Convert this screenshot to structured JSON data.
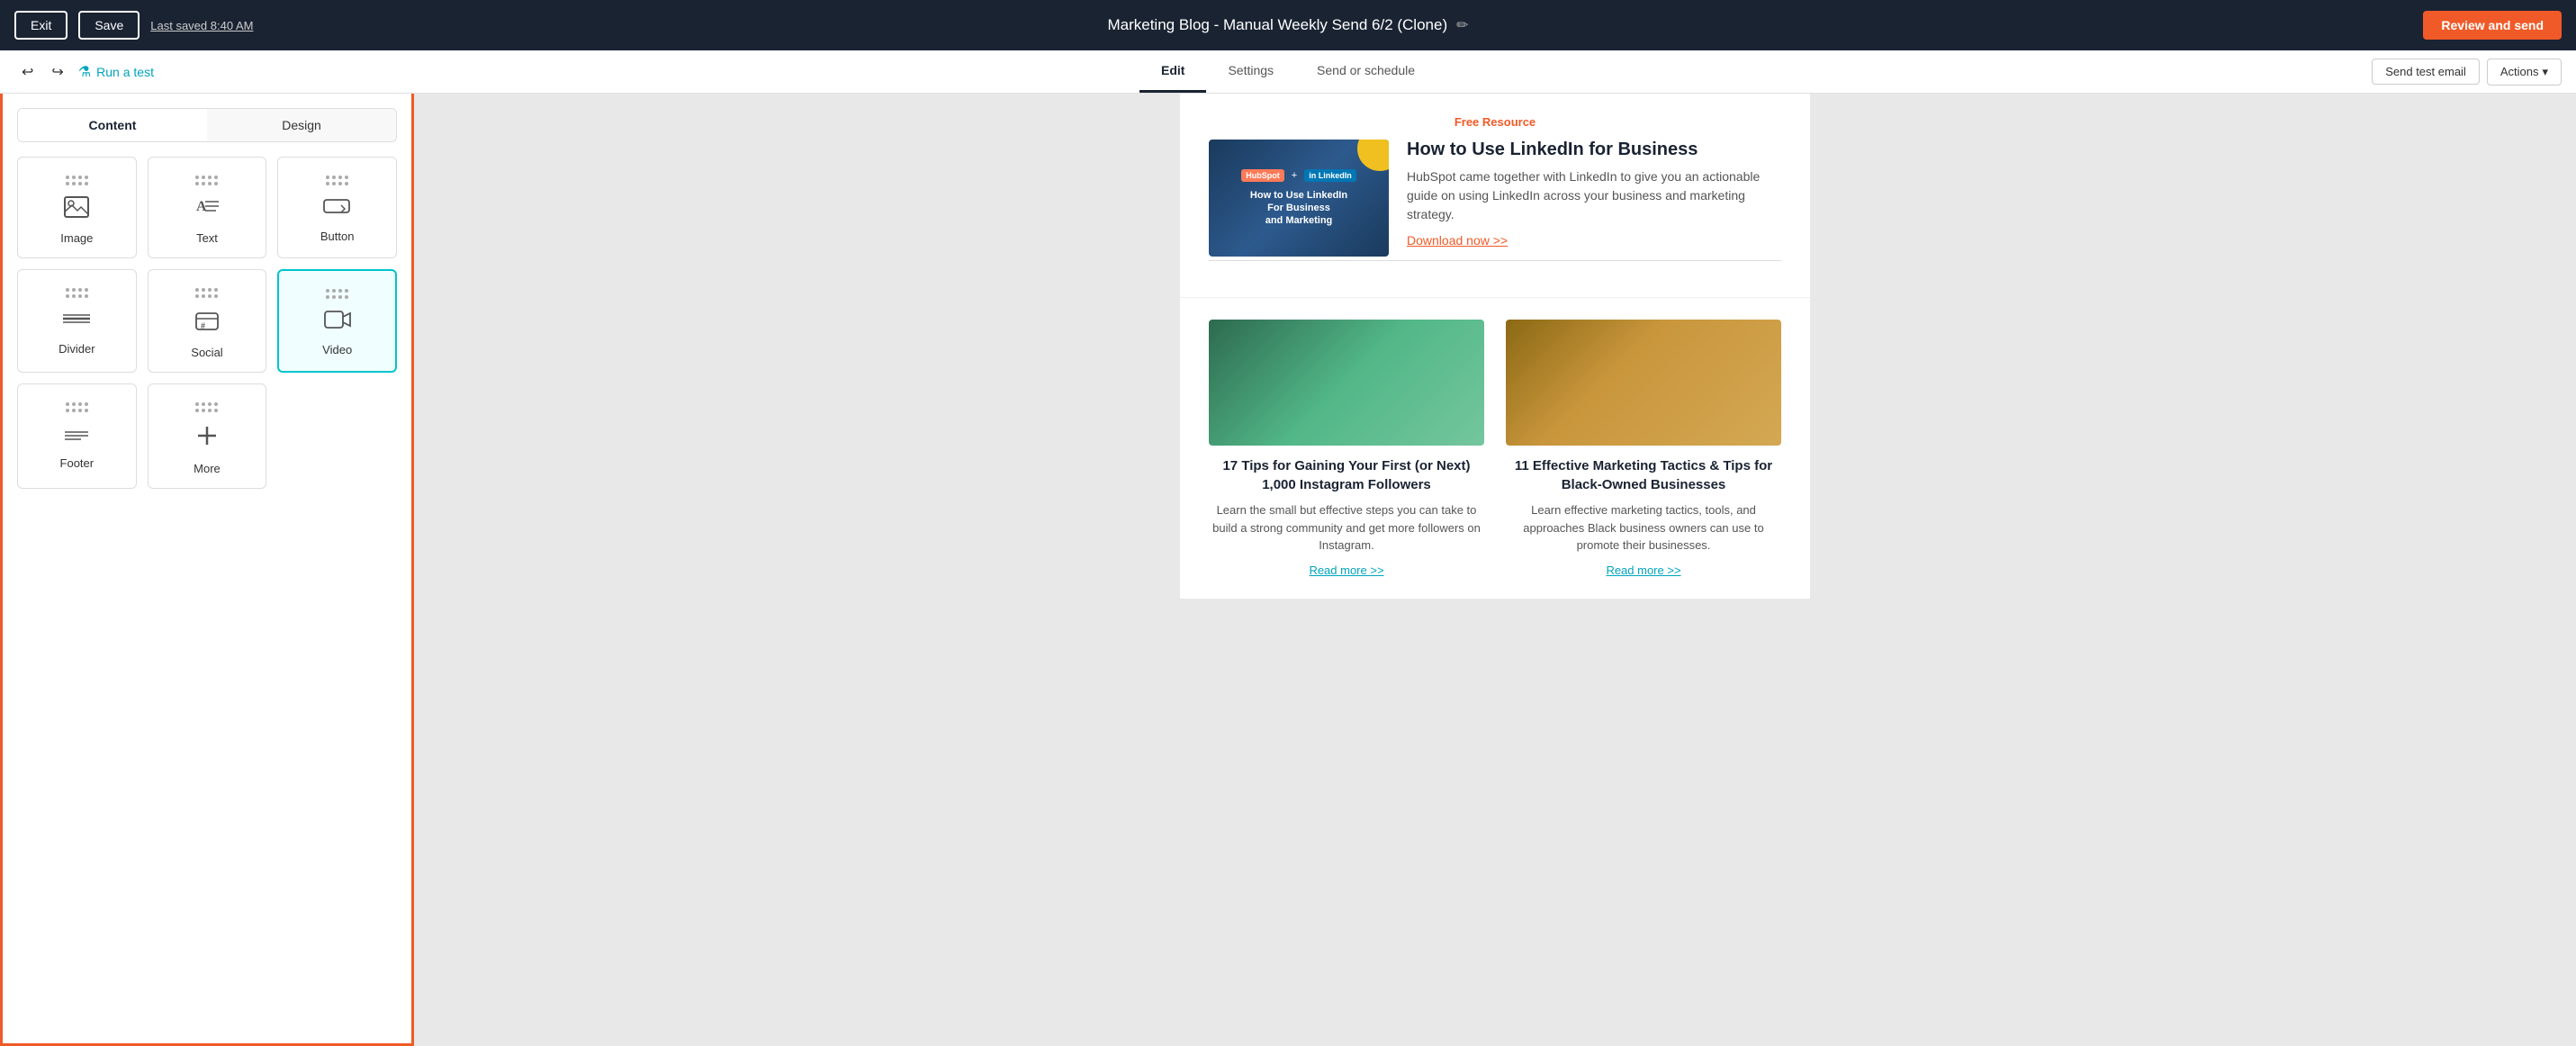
{
  "topbar": {
    "exit_label": "Exit",
    "save_label": "Save",
    "last_saved": "Last saved 8:40 AM",
    "title": "Marketing Blog - Manual Weekly Send 6/2 (Clone)",
    "review_label": "Review and send"
  },
  "secondary": {
    "run_test_label": "Run a test",
    "tabs": [
      {
        "id": "edit",
        "label": "Edit",
        "active": true
      },
      {
        "id": "settings",
        "label": "Settings",
        "active": false
      },
      {
        "id": "send",
        "label": "Send or schedule",
        "active": false
      }
    ],
    "send_test_label": "Send test email",
    "actions_label": "Actions"
  },
  "left_panel": {
    "tabs": [
      {
        "id": "content",
        "label": "Content",
        "active": true
      },
      {
        "id": "design",
        "label": "Design",
        "active": false
      }
    ],
    "widgets": [
      {
        "id": "image",
        "label": "Image",
        "icon": "image"
      },
      {
        "id": "text",
        "label": "Text",
        "icon": "text"
      },
      {
        "id": "button",
        "label": "Button",
        "icon": "button"
      },
      {
        "id": "divider",
        "label": "Divider",
        "icon": "divider"
      },
      {
        "id": "social",
        "label": "Social",
        "icon": "social"
      },
      {
        "id": "video",
        "label": "Video",
        "icon": "video",
        "selected": true
      },
      {
        "id": "footer",
        "label": "Footer",
        "icon": "footer"
      },
      {
        "id": "more",
        "label": "More",
        "icon": "more"
      }
    ]
  },
  "email_preview": {
    "free_resource_label": "Free Resource",
    "resource": {
      "title": "How to Use LinkedIn for Business",
      "description": "HubSpot came together with LinkedIn to give you an actionable guide on using LinkedIn across your business and marketing strategy.",
      "download_link": "Download now >>"
    },
    "articles": [
      {
        "title": "17 Tips for Gaining Your First (or Next) 1,000 Instagram Followers",
        "description": "Learn the small but effective steps you can take to build a strong community and get more followers on Instagram.",
        "read_more": "Read more >>"
      },
      {
        "title": "11 Effective Marketing Tactics & Tips for Black-Owned Businesses",
        "description": "Learn effective marketing tactics, tools, and approaches Black business owners can use to promote their businesses.",
        "read_more": "Read more >>"
      }
    ]
  }
}
